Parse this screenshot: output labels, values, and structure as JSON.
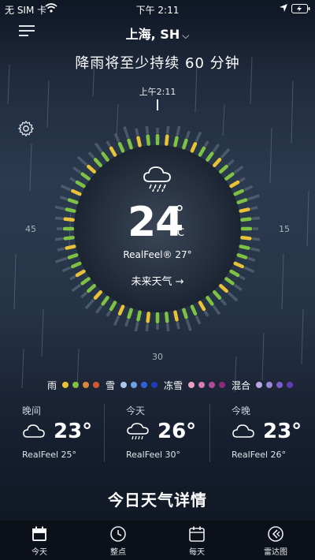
{
  "statusbar": {
    "carrier": "无 SIM 卡",
    "time": "下午 2:11"
  },
  "header": {
    "city": "上海, SH",
    "headline": "降雨将至少持续 60 分钟"
  },
  "dial": {
    "time_label": "上午2:11",
    "label_45": "45",
    "label_15": "15",
    "label_30": "30",
    "temperature": "24",
    "degree": "°",
    "unit": "C",
    "realfeel": "RealFeel® 27°",
    "future_link": "未来天气 →",
    "condition_icon": "rain-cloud-icon",
    "bar_colors": {
      "green": "#7fc243",
      "yellow": "#e9c237",
      "gray": "#5a6575"
    }
  },
  "legend": {
    "rain": {
      "label": "雨",
      "colors": [
        "#e9c237",
        "#7fc243",
        "#d9883a",
        "#d4582f"
      ]
    },
    "snow": {
      "label": "雪",
      "colors": [
        "#a9c7ea",
        "#6aa4e4",
        "#2f61d6",
        "#1f3cb8"
      ]
    },
    "freezing": {
      "label": "冻雪",
      "colors": [
        "#e8a2c8",
        "#d37cb5",
        "#b24b9a",
        "#8a2a7c"
      ]
    },
    "mixed": {
      "label": "混合",
      "colors": [
        "#b8a7e0",
        "#9d86d6",
        "#7b5ec7",
        "#5f3eb0"
      ]
    }
  },
  "forecast": [
    {
      "title": "晚间",
      "temp": "23°",
      "realfeel": "RealFeel 25°",
      "icon": "cloud-icon"
    },
    {
      "title": "今天",
      "temp": "26°",
      "realfeel": "RealFeel 30°",
      "icon": "rain-cloud-icon"
    },
    {
      "title": "今晚",
      "temp": "23°",
      "realfeel": "RealFeel 26°",
      "icon": "cloud-icon"
    }
  ],
  "details_title": "今日天气详情",
  "tabs": [
    {
      "label": "今天",
      "icon": "calendar-today-icon"
    },
    {
      "label": "整点",
      "icon": "clock-icon"
    },
    {
      "label": "每天",
      "icon": "calendar-icon"
    },
    {
      "label": "雷达图",
      "icon": "radar-icon"
    }
  ]
}
